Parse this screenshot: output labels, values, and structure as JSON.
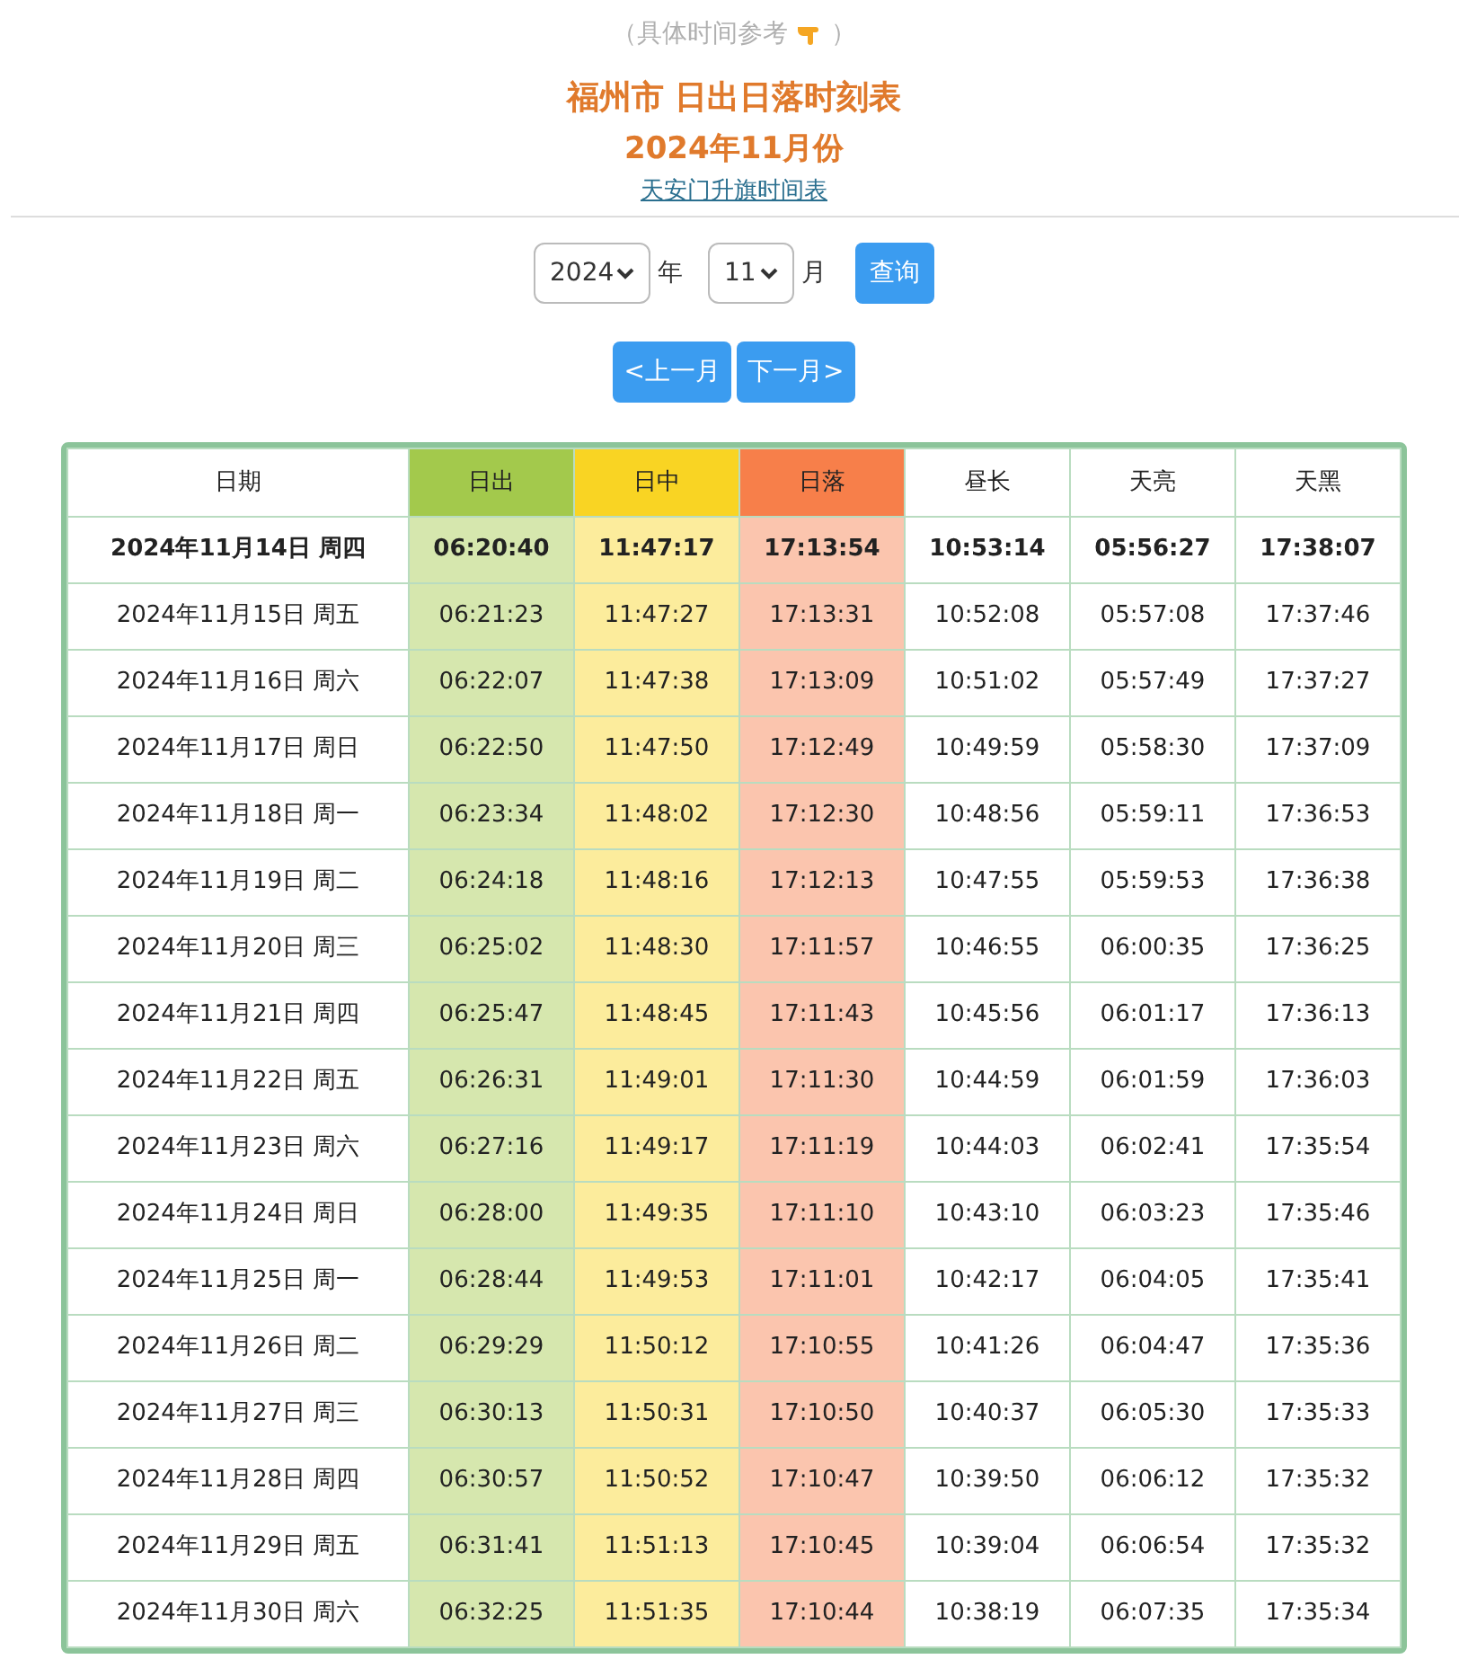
{
  "note": "（具体时间参考",
  "note_close": "）",
  "title": "福州市 日出日落时刻表",
  "subtitle": "2024年11月份",
  "link": "天安门升旗时间表",
  "form": {
    "year": "2024",
    "year_label": "年",
    "month": "11",
    "month_label": "月",
    "query_button": "查询"
  },
  "nav": {
    "prev": "<上一月",
    "next": "下一月>"
  },
  "table": {
    "columns": [
      {
        "label": "日期"
      },
      {
        "label": "日出",
        "color": "#a3c94c"
      },
      {
        "label": "日中",
        "color": "#f9d423"
      },
      {
        "label": "日落",
        "color": "#f77f4a"
      },
      {
        "label": "昼长"
      },
      {
        "label": "天亮"
      },
      {
        "label": "天黑"
      }
    ],
    "rows": [
      {
        "current": true,
        "cells": [
          "2024年11月14日 周四",
          "06:20:40",
          "11:47:17",
          "17:13:54",
          "10:53:14",
          "05:56:27",
          "17:38:07"
        ]
      },
      {
        "current": false,
        "cells": [
          "2024年11月15日 周五",
          "06:21:23",
          "11:47:27",
          "17:13:31",
          "10:52:08",
          "05:57:08",
          "17:37:46"
        ]
      },
      {
        "current": false,
        "cells": [
          "2024年11月16日 周六",
          "06:22:07",
          "11:47:38",
          "17:13:09",
          "10:51:02",
          "05:57:49",
          "17:37:27"
        ]
      },
      {
        "current": false,
        "cells": [
          "2024年11月17日 周日",
          "06:22:50",
          "11:47:50",
          "17:12:49",
          "10:49:59",
          "05:58:30",
          "17:37:09"
        ]
      },
      {
        "current": false,
        "cells": [
          "2024年11月18日 周一",
          "06:23:34",
          "11:48:02",
          "17:12:30",
          "10:48:56",
          "05:59:11",
          "17:36:53"
        ]
      },
      {
        "current": false,
        "cells": [
          "2024年11月19日 周二",
          "06:24:18",
          "11:48:16",
          "17:12:13",
          "10:47:55",
          "05:59:53",
          "17:36:38"
        ]
      },
      {
        "current": false,
        "cells": [
          "2024年11月20日 周三",
          "06:25:02",
          "11:48:30",
          "17:11:57",
          "10:46:55",
          "06:00:35",
          "17:36:25"
        ]
      },
      {
        "current": false,
        "cells": [
          "2024年11月21日 周四",
          "06:25:47",
          "11:48:45",
          "17:11:43",
          "10:45:56",
          "06:01:17",
          "17:36:13"
        ]
      },
      {
        "current": false,
        "cells": [
          "2024年11月22日 周五",
          "06:26:31",
          "11:49:01",
          "17:11:30",
          "10:44:59",
          "06:01:59",
          "17:36:03"
        ]
      },
      {
        "current": false,
        "cells": [
          "2024年11月23日 周六",
          "06:27:16",
          "11:49:17",
          "17:11:19",
          "10:44:03",
          "06:02:41",
          "17:35:54"
        ]
      },
      {
        "current": false,
        "cells": [
          "2024年11月24日 周日",
          "06:28:00",
          "11:49:35",
          "17:11:10",
          "10:43:10",
          "06:03:23",
          "17:35:46"
        ]
      },
      {
        "current": false,
        "cells": [
          "2024年11月25日 周一",
          "06:28:44",
          "11:49:53",
          "17:11:01",
          "10:42:17",
          "06:04:05",
          "17:35:41"
        ]
      },
      {
        "current": false,
        "cells": [
          "2024年11月26日 周二",
          "06:29:29",
          "11:50:12",
          "17:10:55",
          "10:41:26",
          "06:04:47",
          "17:35:36"
        ]
      },
      {
        "current": false,
        "cells": [
          "2024年11月27日 周三",
          "06:30:13",
          "11:50:31",
          "17:10:50",
          "10:40:37",
          "06:05:30",
          "17:35:33"
        ]
      },
      {
        "current": false,
        "cells": [
          "2024年11月28日 周四",
          "06:30:57",
          "11:50:52",
          "17:10:47",
          "10:39:50",
          "06:06:12",
          "17:35:32"
        ]
      },
      {
        "current": false,
        "cells": [
          "2024年11月29日 周五",
          "06:31:41",
          "11:51:13",
          "17:10:45",
          "10:39:04",
          "06:06:54",
          "17:35:32"
        ]
      },
      {
        "current": false,
        "cells": [
          "2024年11月30日 周六",
          "06:32:25",
          "11:51:35",
          "17:10:44",
          "10:38:19",
          "06:07:35",
          "17:35:34"
        ]
      }
    ]
  }
}
